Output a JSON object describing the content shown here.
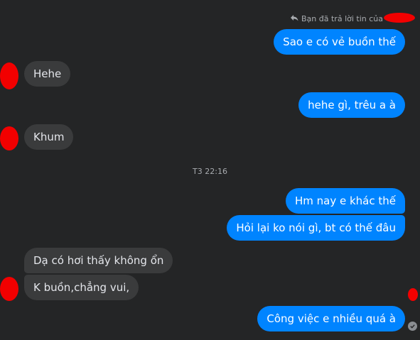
{
  "reply_note": {
    "text": "Bạn đã trả lời tin của"
  },
  "timestamp": "T3 22:16",
  "messages": [
    {
      "side": "out",
      "text": "Sao e có vẻ buồn thế"
    },
    {
      "side": "in",
      "text": "Hehe"
    },
    {
      "side": "out",
      "text": "hehe gì, trêu a à"
    },
    {
      "side": "in",
      "text": "Khum"
    },
    {
      "side": "out",
      "text": "Hm nay e khác thế"
    },
    {
      "side": "out",
      "text": "Hỏi lại ko nói gì, bt có thế đâu"
    },
    {
      "side": "in",
      "text": "Dạ có hơi thấy không ổn"
    },
    {
      "side": "in",
      "text": "K buồn,chẳng vui,"
    },
    {
      "side": "out",
      "text": "Công việc e nhiều quá à"
    }
  ],
  "colors": {
    "background": "#242526",
    "outgoing_bubble": "#0084ff",
    "incoming_bubble": "#3a3b3c",
    "redaction": "#f20000"
  },
  "icons": {
    "reply": "reply-arrow-icon",
    "seen": "seen-check-icon"
  }
}
